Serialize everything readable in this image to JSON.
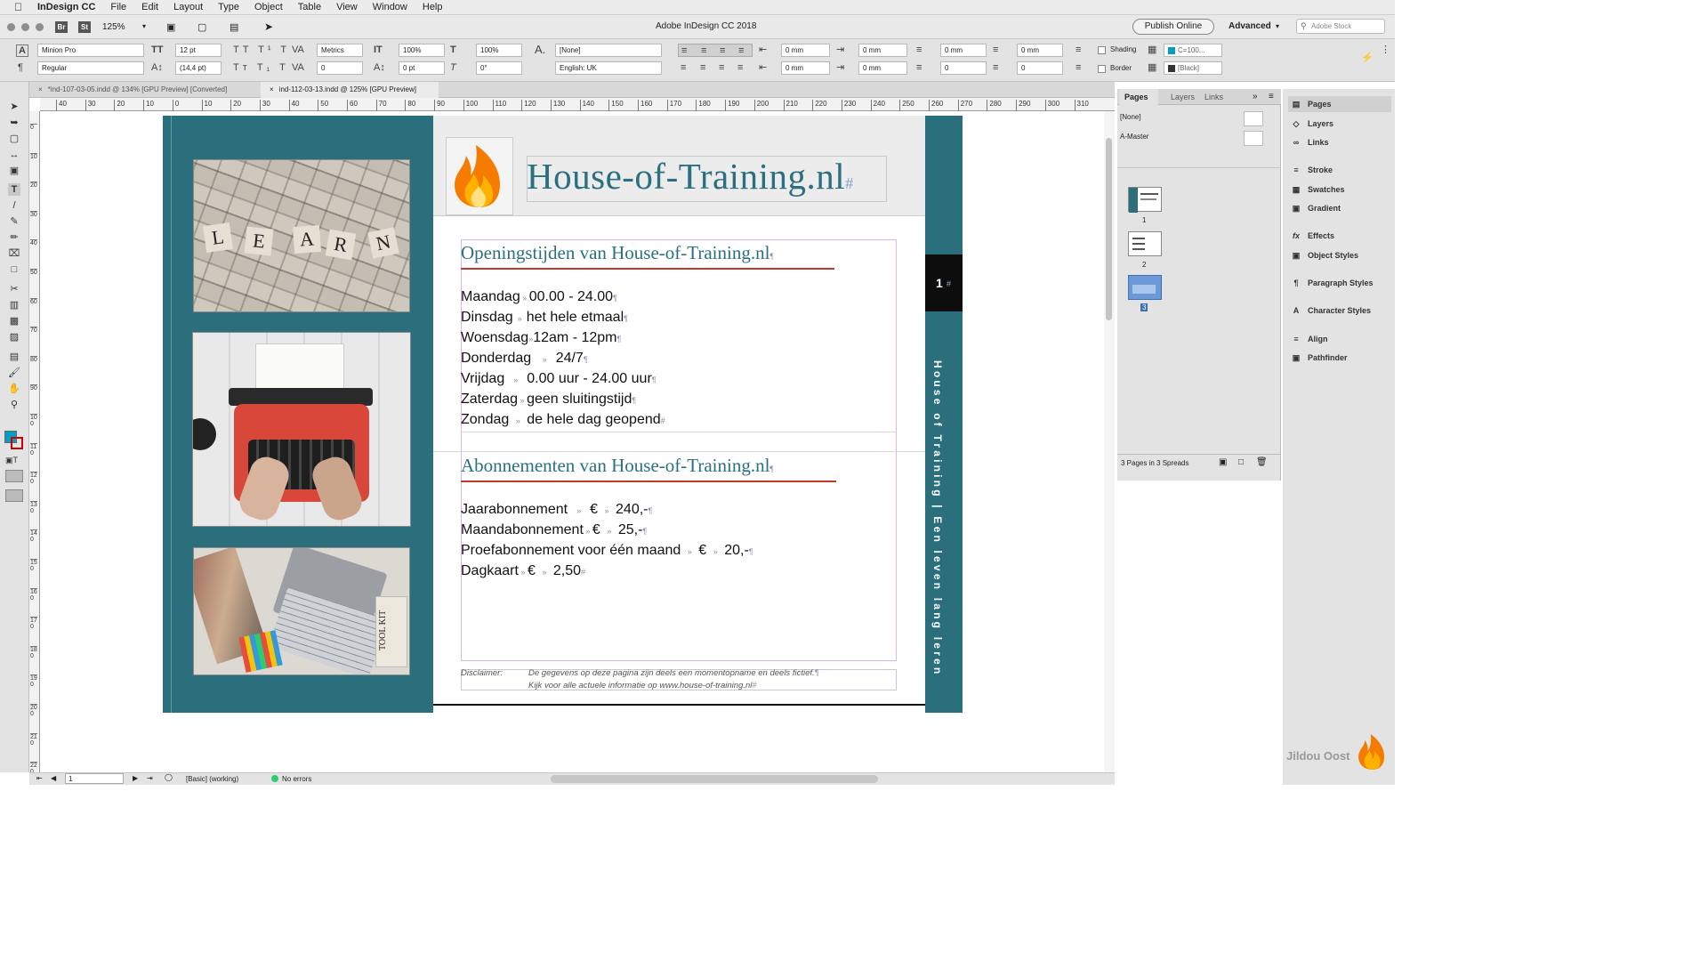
{
  "menubar": {
    "apple": "",
    "app": "InDesign CC",
    "items": [
      "File",
      "Edit",
      "Layout",
      "Type",
      "Object",
      "Table",
      "View",
      "Window",
      "Help"
    ]
  },
  "titlebar": {
    "title": "Adobe InDesign CC 2018",
    "zoom": "125%",
    "br": "Br",
    "st": "St",
    "publish": "Publish Online",
    "workspace": "Advanced",
    "stock_placeholder": "Adobe Stock"
  },
  "control": {
    "font": "Minion Pro",
    "style": "Regular",
    "size": "12 pt",
    "leading": "(14,4 pt)",
    "kerning": "Metrics",
    "tracking": "0",
    "vscale": "100%",
    "hscale": "100%",
    "baseline": "0 pt",
    "skew": "0°",
    "char_style": "[None]",
    "language": "English: UK",
    "indents": [
      "0 mm",
      "0 mm",
      "0 mm",
      "0 mm"
    ],
    "spacing": [
      "0 mm",
      "0 mm",
      "0",
      "0"
    ],
    "shading": "Shading",
    "border": "Border",
    "swatch1": "C=100...",
    "swatch2": "[Black]"
  },
  "tabs": [
    {
      "label": "*ind-107-03-05.indd @ 134% [GPU Preview] [Converted]",
      "active": false
    },
    {
      "label": "ind-112-03-13.indd @ 125% [GPU Preview]",
      "active": true
    }
  ],
  "ruler_labels": [
    "40",
    "30",
    "20",
    "10",
    "0",
    "10",
    "20",
    "30",
    "40",
    "50",
    "60",
    "70",
    "80",
    "90",
    "100",
    "110",
    "120",
    "130",
    "140",
    "150",
    "160",
    "170",
    "180",
    "190",
    "200",
    "210",
    "220",
    "230",
    "240",
    "250",
    "260",
    "270",
    "280",
    "290",
    "300",
    "310"
  ],
  "vruler_labels": [
    "0",
    "10",
    "20",
    "30",
    "40",
    "50",
    "60",
    "70",
    "80",
    "90",
    "100",
    "110",
    "120",
    "130",
    "140",
    "150",
    "160",
    "170",
    "180",
    "190",
    "200",
    "210",
    "220"
  ],
  "document": {
    "title": "House-of-Training.nl",
    "title_mark": "#",
    "page_number": "1",
    "page_mark": "#",
    "photo1_letters": [
      "L",
      "E",
      "A",
      "R",
      "N"
    ],
    "photo3_tag": "TOOL KIT",
    "vertical_text": "House of Training | Een leven lang leren",
    "section1": {
      "heading": "Openingstijden van House-of-Training.nl",
      "rows": [
        {
          "day": "Maandag",
          "time": "00.00 - 24.00"
        },
        {
          "day": "Dinsdag",
          "time": "het hele etmaal"
        },
        {
          "day": "Woensdag",
          "time": "12am - 12pm"
        },
        {
          "day": "Donderdag",
          "time": "24/7"
        },
        {
          "day": "Vrijdag",
          "time": "0.00 uur - 24.00 uur"
        },
        {
          "day": "Zaterdag",
          "time": "geen sluitingstijd"
        },
        {
          "day": "Zondag",
          "time": "de hele dag geopend"
        }
      ]
    },
    "section2": {
      "heading": "Abonnementen van House-of-Training.nl",
      "rows": [
        {
          "name": "Jaarabonnement",
          "currency": "€",
          "price": "240,-"
        },
        {
          "name": "Maandabonnement",
          "currency": "€",
          "price": "25,-"
        },
        {
          "name": "Proefabonnement voor één maand",
          "currency": "€",
          "price": "20,-"
        },
        {
          "name": "Dagkaart",
          "currency": "€",
          "price": "2,50"
        }
      ]
    },
    "disclaimer_label": "Disclaimer:",
    "disclaimer_line1": "De gegevens op deze pagina zijn deels een momentopname en deels fictief.",
    "disclaimer_line2": "Kijk voor alle actuele informatie op www.house-of-training.nl"
  },
  "pages_panel": {
    "tabs": [
      "Pages",
      "Layers",
      "Links"
    ],
    "none_label": "[None]",
    "master_label": "A-Master",
    "page_nums": [
      "1",
      "2",
      "3"
    ],
    "footer": "3 Pages in 3 Spreads"
  },
  "dock": [
    "Pages",
    "Layers",
    "Links",
    "Stroke",
    "Swatches",
    "Gradient",
    "Effects",
    "Object Styles",
    "Paragraph Styles",
    "Character Styles",
    "Align",
    "Pathfinder"
  ],
  "status": {
    "page": "1",
    "style": "[Basic] (working)",
    "errors": "No errors"
  },
  "watermark": "Jildou Oost",
  "colors": {
    "teal": "#2b6e7c",
    "heading": "#2b7080",
    "rule": "#c0392b",
    "accent": "#00a0c6"
  }
}
